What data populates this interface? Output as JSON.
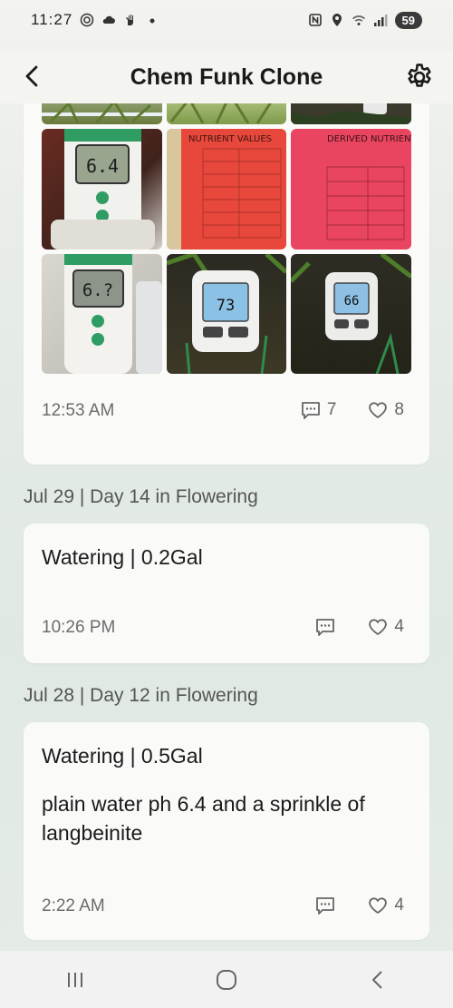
{
  "status_bar": {
    "time": "11:27",
    "battery": "59",
    "icons": [
      "circle-icon",
      "cloud-icon",
      "hand-icon",
      "dot-icon",
      "nfc-icon",
      "location-icon",
      "wifi-icon",
      "signal-icon"
    ]
  },
  "header": {
    "title": "Chem Funk Clone",
    "back_icon": "back-arrow-icon",
    "settings_icon": "gear-icon"
  },
  "post1": {
    "time": "12:53 AM",
    "comments": "7",
    "likes": "8",
    "photos": [
      {
        "caption": "grow-tent-plants"
      },
      {
        "caption": "grow-tent-plants"
      },
      {
        "caption": "soil-meter"
      },
      {
        "caption": "ph-meter",
        "reading": "6.4"
      },
      {
        "caption": "nutrient-values",
        "heading": "NUTRIENT VALUES"
      },
      {
        "caption": "derived-nutrient-values",
        "heading": "DERIVED NUTRIENT VALUES"
      },
      {
        "caption": "ph-meter",
        "reading": "6.?"
      },
      {
        "caption": "soil-tester",
        "reading": "73"
      },
      {
        "caption": "soil-tester",
        "reading": "66"
      }
    ]
  },
  "day_heading_1": "Jul 29 | Day 14 in Flowering",
  "post2": {
    "title": "Watering | 0.2Gal",
    "time": "10:26 PM",
    "likes": "4"
  },
  "day_heading_2": "Jul 28 | Day 12 in Flowering",
  "post3": {
    "title": "Watering | 0.5Gal",
    "body": "plain water ph 6.4 and a sprinkle of langbeinite",
    "time": "2:22 AM",
    "likes": "4"
  },
  "nav": {
    "recents_icon": "recents-icon",
    "home_icon": "home-icon",
    "back_icon": "nav-back-icon"
  },
  "colors": {
    "tag_red": "#e8473c",
    "tag_pink": "#e94560",
    "meter_green": "#2f9c63"
  }
}
